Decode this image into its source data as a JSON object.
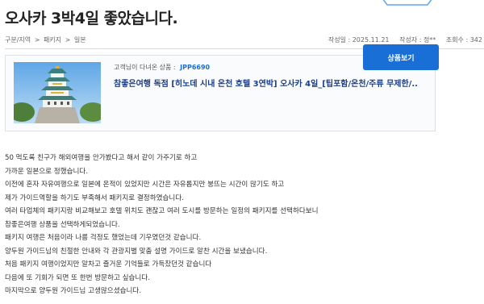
{
  "post": {
    "title": "오사카 3박4일 좋았습니다."
  },
  "breadcrumb": {
    "items": [
      "구분/지역",
      ">",
      "패키지",
      ">",
      "일본"
    ]
  },
  "meta": {
    "date_label": "작성일 : 2025.11.21",
    "author_label": "작성자 : 정**",
    "views_label": "조회수 : 342"
  },
  "product": {
    "label": "고객님이 다녀온 상품 :",
    "code": "JPP6690",
    "name": "참좋은여행 독점 [히노데 시내 온천 호텔 3연박] 오사카 4일_[팁포함/온천/주류 무제한/..",
    "button_label": "상품보기",
    "image_icon": "osaka-castle-photo"
  },
  "content": {
    "lines": [
      "50 먹도록 친구가 해외여행을 안가봤다고 해서 같이 가주기로 하고",
      "가까운 일본으로 정했습니다.",
      "이전에 혼자 자유여행으로 일본에 온적이 있었지만 시간은 자유롭지만 붕뜨는 시간이 많기도 하고",
      "제가 가이드역할을 하기도 부족해서 패키지로 결정하였습니다.",
      "여러 타업체의 패키지랑 비교해보고 호텔 위치도 괜찮고 여러 도시를 방문하는 일정의 패키지를 선택하다보니",
      "참좋은여행 상품을 선택하게되었습니다.",
      "패키지 여행은 처음이라 나름 걱정도 했었는데 기우였던것 같습니다.",
      "양두원 가이드님의 친절한 안내와 각 관광지별 맞춤 설명 가이드로 알찬 시간을 보냈습니다.",
      "처음 패키지 여행이었지만 알차고 즐거운 기억들로 가득찼던것 같습니다",
      "다음에 또 기회가 되면 또 한번 방문하고 싶습니다.",
      "마지막으로 양두원 가이드님 고생많으셨습니다."
    ]
  }
}
